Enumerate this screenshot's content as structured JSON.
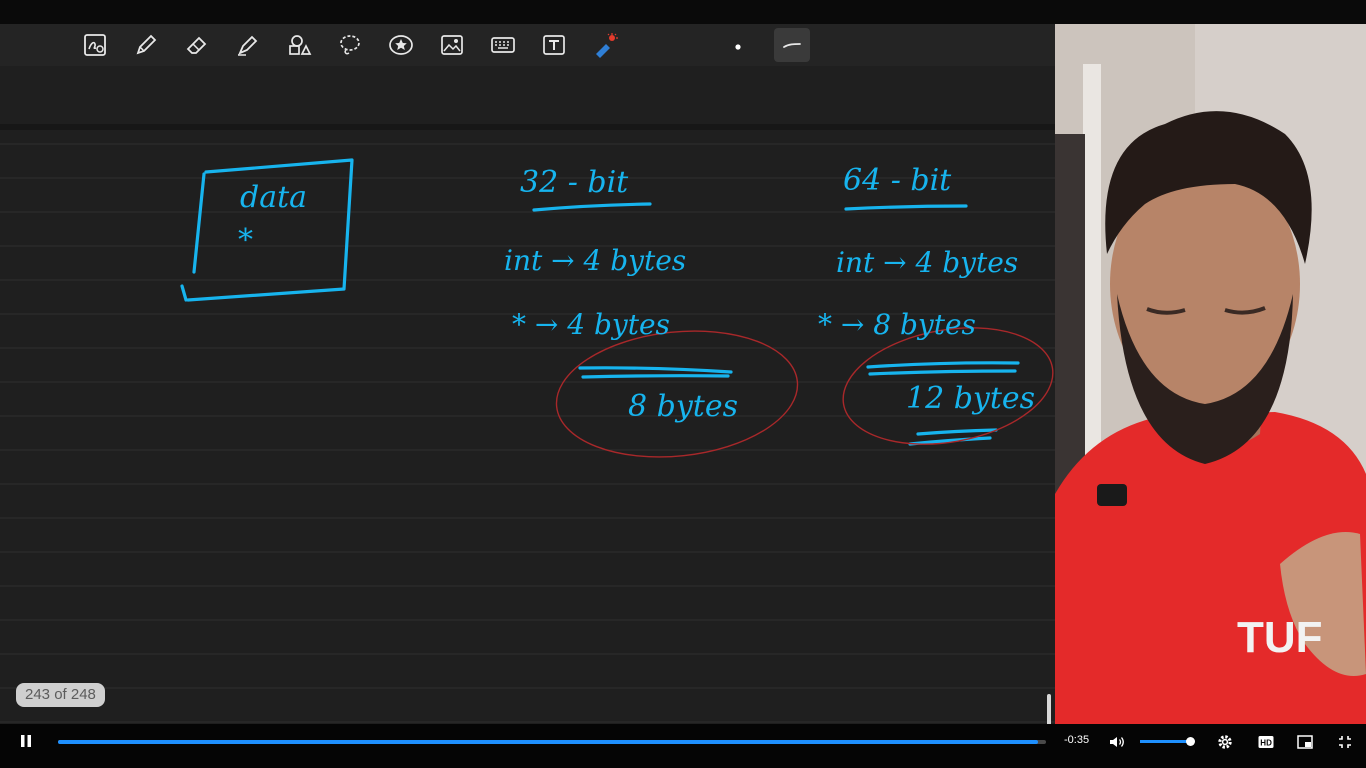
{
  "notes": {
    "toolbar": {
      "tools": [
        {
          "name": "zoom-pen-icon"
        },
        {
          "name": "pen-icon"
        },
        {
          "name": "eraser-icon"
        },
        {
          "name": "highlighter-icon"
        },
        {
          "name": "shapes-icon"
        },
        {
          "name": "lasso-icon"
        },
        {
          "name": "sticker-icon"
        },
        {
          "name": "image-icon"
        },
        {
          "name": "keyboard-icon"
        },
        {
          "name": "text-box-icon"
        },
        {
          "name": "laser-pointer-icon"
        },
        {
          "name": "dot-size-icon"
        },
        {
          "name": "stroke-style-icon"
        }
      ]
    },
    "page_counter": "243 of 248",
    "ink_color": "#17b4ee",
    "circle_color": "#a8282a",
    "handwriting": {
      "box_label_1": "data",
      "box_label_2": "*",
      "col1_heading": "32 - bit",
      "col2_heading": "64 - bit",
      "col1_row1": "int → 4 bytes",
      "col1_row2": "* → 4 bytes",
      "col1_total": "8 bytes",
      "col2_row1": "int → 4 bytes",
      "col2_row2": "* → 8 bytes",
      "col2_total": "12 bytes"
    }
  },
  "player": {
    "progress_percent": 99.2,
    "time_remaining": "-0:35",
    "volume_percent": 96,
    "accent_color": "#1e90ff",
    "buttons": [
      "pause-icon",
      "volume-icon",
      "settings-icon",
      "hd-icon",
      "miniplayer-icon",
      "exit-fullscreen-icon"
    ]
  },
  "webcam": {
    "shirt_color": "#e42a2a",
    "shirt_logo": "TUF"
  }
}
